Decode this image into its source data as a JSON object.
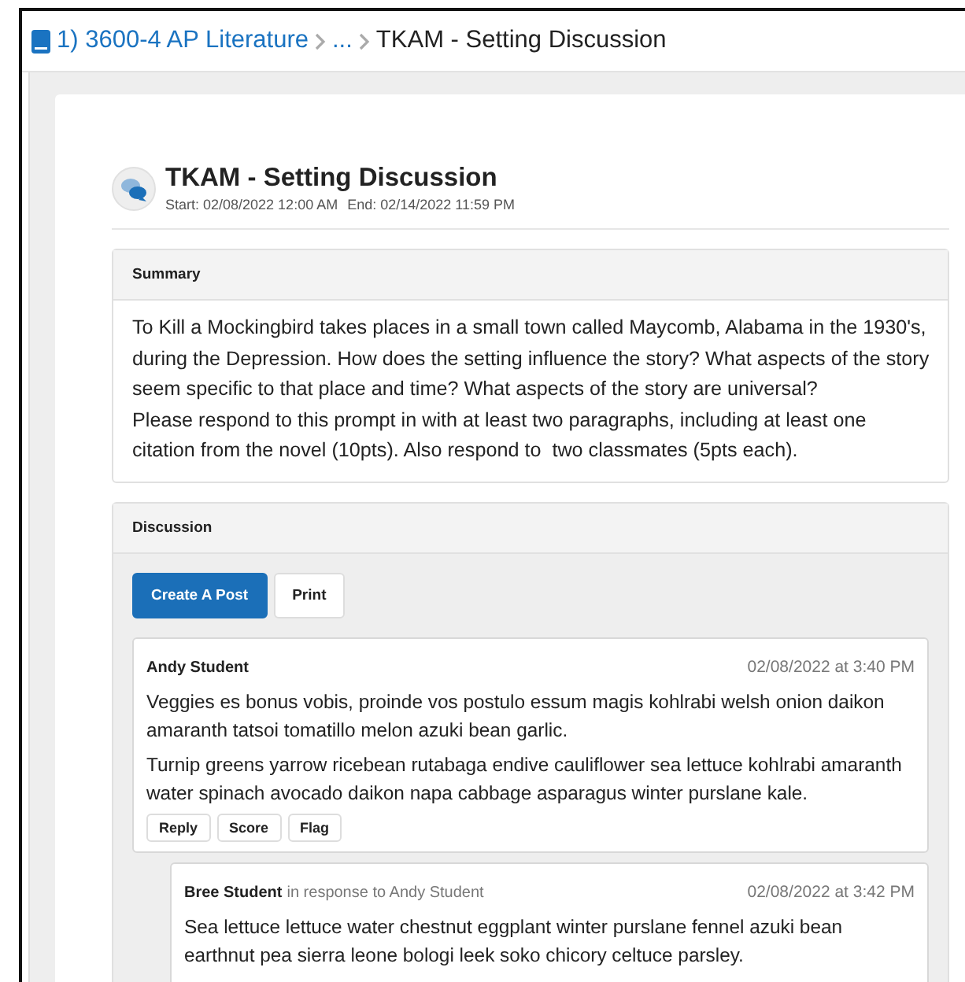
{
  "breadcrumb": {
    "course": "1) 3600-4 AP Literature",
    "ellipsis": "...",
    "current": "TKAM - Setting Discussion"
  },
  "header": {
    "title": "TKAM - Setting Discussion",
    "start": "Start: 02/08/2022 12:00 AM",
    "end": "End: 02/14/2022 11:59 PM"
  },
  "summary": {
    "heading": "Summary",
    "paragraphs": [
      "To Kill a Mockingbird takes places in a small town called Maycomb, Alabama in the 1930's, during the Depression. How does the setting influence the story? What aspects of the story seem specific to that place and time? What aspects of the story are universal?",
      "Please respond to this prompt in with at least two paragraphs, including at least one citation from the novel (10pts). Also respond to  two classmates (5pts each)."
    ]
  },
  "discussion": {
    "heading": "Discussion",
    "buttons": [
      {
        "label": "Create A Post",
        "kind": "primary"
      },
      {
        "label": "Print",
        "kind": "secondary"
      }
    ],
    "posts": [
      {
        "author": "Andy Student",
        "date": "02/08/2022 at 3:40 PM",
        "paragraphs": [
          "Veggies es bonus vobis, proinde vos postulo essum magis kohlrabi welsh onion daikon amaranth tatsoi tomatillo melon azuki bean garlic.",
          "Turnip greens yarrow ricebean rutabaga endive cauliflower sea lettuce kohlrabi amaranth water spinach avocado daikon napa cabbage asparagus winter purslane kale."
        ],
        "actions": [
          "Reply",
          "Score",
          "Flag"
        ],
        "children": [
          {
            "author": "Bree Student",
            "response_to": "in response to Andy Student",
            "date": "02/08/2022 at 3:42 PM",
            "paragraphs": [
              "Sea lettuce lettuce water chestnut eggplant winter purslane fennel azuki bean earthnut pea sierra leone bologi leek soko chicory celtuce parsley."
            ]
          }
        ]
      }
    ]
  }
}
